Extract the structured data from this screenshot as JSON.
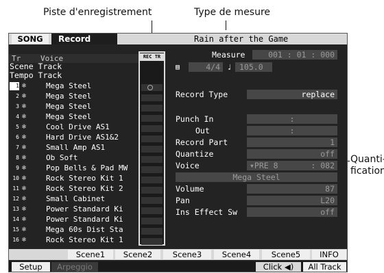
{
  "annotations": {
    "rec_track": "Piste d'enregistrement",
    "meter": "Type de mesure",
    "quant_1": "Quanti-",
    "quant_2": "fication"
  },
  "header": {
    "song": "SONG",
    "mode": "Record",
    "song_name": "Rain after the Game"
  },
  "columns": {
    "track": "Tr",
    "voice": "Voice",
    "rec_tr": "REC TR"
  },
  "fixed_tracks": {
    "scene": "Scene Track",
    "tempo": "Tempo Track"
  },
  "tracks": [
    {
      "num": "1",
      "voice": "Mega Steel",
      "rec": true
    },
    {
      "num": "2",
      "voice": "Mega Steel",
      "rec": false
    },
    {
      "num": "3",
      "voice": "Mega Steel",
      "rec": false
    },
    {
      "num": "4",
      "voice": "Mega Steel",
      "rec": false
    },
    {
      "num": "5",
      "voice": "Cool Drive AS1",
      "rec": false
    },
    {
      "num": "6",
      "voice": "Hard Drive AS1&2",
      "rec": false
    },
    {
      "num": "7",
      "voice": "Small Amp AS1",
      "rec": false
    },
    {
      "num": "8",
      "voice": "Ob Soft",
      "rec": false
    },
    {
      "num": "9",
      "voice": "Pop Bells & Pad MW",
      "rec": false
    },
    {
      "num": "10",
      "voice": "Rock Stereo Kit 1",
      "rec": false
    },
    {
      "num": "11",
      "voice": "Rock Stereo Kit 2",
      "rec": false
    },
    {
      "num": "12",
      "voice": "Small Cabinet",
      "rec": false
    },
    {
      "num": "13",
      "voice": "Power Standard Ki",
      "rec": false
    },
    {
      "num": "14",
      "voice": "Power Standard Ki",
      "rec": false
    },
    {
      "num": "15",
      "voice": "Mega 60s Dist Sta",
      "rec": false
    },
    {
      "num": "16",
      "voice": "Rock Stereo Kit 1",
      "rec": false
    }
  ],
  "measure": {
    "label": "Measure",
    "value": "001 : 01 : 000",
    "meter": "4/4",
    "tempo": "105.0"
  },
  "params": {
    "record_type": {
      "label": "Record Type",
      "value": "replace"
    },
    "punch_in": {
      "label": "Punch In",
      "value": ":"
    },
    "out": {
      "label": "Out",
      "value": ":"
    },
    "record_part": {
      "label": "Record Part",
      "value": "1"
    },
    "quantize": {
      "label": "Quantize",
      "value": "off"
    },
    "voice": {
      "label": "Voice",
      "bank": "▾PRE 8",
      "num": ": 082",
      "name": "Mega Steel"
    },
    "volume": {
      "label": "Volume",
      "value": "87"
    },
    "pan": {
      "label": "Pan",
      "value": "L20"
    },
    "ins_effect": {
      "label": "Ins Effect Sw",
      "value": "off"
    }
  },
  "scenes": [
    "Scene1",
    "Scene2",
    "Scene3",
    "Scene4",
    "Scene5",
    "INFO"
  ],
  "bottom": {
    "setup": "Setup",
    "arpeggio": "Arpeggio",
    "click": "Click ◀)",
    "all_track": "All Track"
  }
}
